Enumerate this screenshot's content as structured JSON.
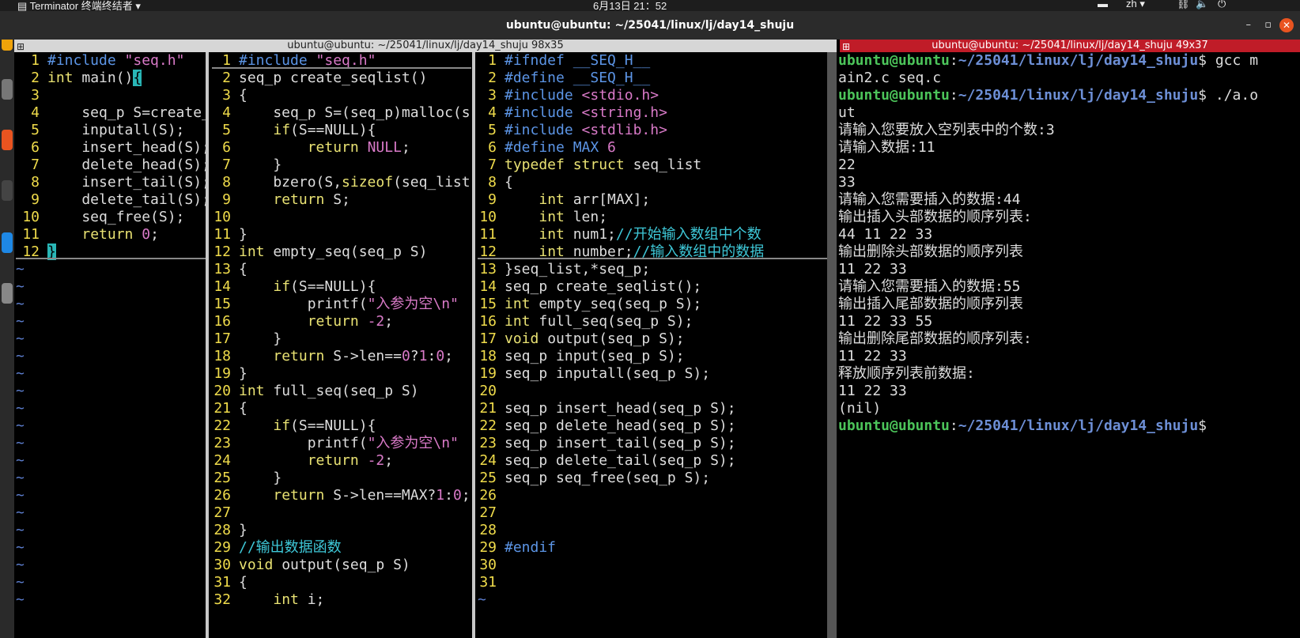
{
  "topbar": {
    "app_name": "Terminator 终端终结者",
    "clock": "6月13日 21：52",
    "input_method": "zh"
  },
  "window": {
    "title": "ubuntu@ubuntu: ~/25041/linux/lj/day14_shuju",
    "min": "–",
    "max": "▫",
    "close": "✕"
  },
  "left_bar": {
    "title": "ubuntu@ubuntu: ~/25041/linux/lj/day14_shuju 98x35"
  },
  "right_bar": {
    "title": "ubuntu@ubuntu: ~/25041/linux/lj/day14_shuju 49x37"
  },
  "pane1": {
    "lines": [
      [
        {
          "t": "#include ",
          "c": "pp"
        },
        {
          "t": "\"seq.h\"",
          "c": "str"
        }
      ],
      [
        {
          "t": "int",
          "c": "ty"
        },
        {
          "t": " main()",
          "c": "pl"
        },
        {
          "t": "{",
          "c": "cur"
        }
      ],
      [],
      [
        {
          "t": "    seq_p S=create_",
          "c": "pl"
        }
      ],
      [
        {
          "t": "    inputall(S);",
          "c": "pl"
        }
      ],
      [
        {
          "t": "    insert_head(S);",
          "c": "pl"
        }
      ],
      [
        {
          "t": "    delete_head(S);",
          "c": "pl"
        }
      ],
      [
        {
          "t": "    insert_tail(S);",
          "c": "pl"
        }
      ],
      [
        {
          "t": "    delete_tail(S);",
          "c": "pl"
        }
      ],
      [
        {
          "t": "    seq_free(S);",
          "c": "pl"
        }
      ],
      [
        {
          "t": "    ",
          "c": "pl"
        },
        {
          "t": "return",
          "c": "kw"
        },
        {
          "t": " ",
          "c": "pl"
        },
        {
          "t": "0",
          "c": "cn"
        },
        {
          "t": ";",
          "c": "pl"
        }
      ],
      [
        {
          "t": "}",
          "c": "cur"
        }
      ]
    ],
    "tildes": 20
  },
  "pane2": {
    "lines": [
      [
        {
          "t": "#include ",
          "c": "pp"
        },
        {
          "t": "\"seq.h\"",
          "c": "str"
        }
      ],
      [
        {
          "t": "seq_p create_seqlist()",
          "c": "pl"
        }
      ],
      [
        {
          "t": "{",
          "c": "pl"
        }
      ],
      [
        {
          "t": "    seq_p S=(seq_p)malloc(s",
          "c": "pl"
        }
      ],
      [
        {
          "t": "    ",
          "c": "pl"
        },
        {
          "t": "if",
          "c": "kw"
        },
        {
          "t": "(S==NULL){",
          "c": "pl"
        }
      ],
      [
        {
          "t": "        ",
          "c": "pl"
        },
        {
          "t": "return",
          "c": "kw"
        },
        {
          "t": " ",
          "c": "pl"
        },
        {
          "t": "NULL",
          "c": "cn"
        },
        {
          "t": ";",
          "c": "pl"
        }
      ],
      [
        {
          "t": "    }",
          "c": "pl"
        }
      ],
      [
        {
          "t": "    bzero(S,",
          "c": "pl"
        },
        {
          "t": "sizeof",
          "c": "kw"
        },
        {
          "t": "(seq_list",
          "c": "pl"
        }
      ],
      [
        {
          "t": "    ",
          "c": "pl"
        },
        {
          "t": "return",
          "c": "kw"
        },
        {
          "t": " S;",
          "c": "pl"
        }
      ],
      [],
      [
        {
          "t": "}",
          "c": "pl"
        }
      ],
      [
        {
          "t": "int",
          "c": "ty"
        },
        {
          "t": " empty_seq(seq_p S)",
          "c": "pl"
        }
      ],
      [
        {
          "t": "{",
          "c": "pl"
        }
      ],
      [
        {
          "t": "    ",
          "c": "pl"
        },
        {
          "t": "if",
          "c": "kw"
        },
        {
          "t": "(S==NULL){",
          "c": "pl"
        }
      ],
      [
        {
          "t": "        printf(",
          "c": "pl"
        },
        {
          "t": "\"入参为空\\n\"",
          "c": "str"
        }
      ],
      [
        {
          "t": "        ",
          "c": "pl"
        },
        {
          "t": "return",
          "c": "kw"
        },
        {
          "t": " ",
          "c": "pl"
        },
        {
          "t": "-2",
          "c": "cn"
        },
        {
          "t": ";",
          "c": "pl"
        }
      ],
      [
        {
          "t": "    }",
          "c": "pl"
        }
      ],
      [
        {
          "t": "    ",
          "c": "pl"
        },
        {
          "t": "return",
          "c": "kw"
        },
        {
          "t": " S->len==",
          "c": "pl"
        },
        {
          "t": "0",
          "c": "cn"
        },
        {
          "t": "?",
          "c": "pl"
        },
        {
          "t": "1",
          "c": "cn"
        },
        {
          "t": ":",
          "c": "pl"
        },
        {
          "t": "0",
          "c": "cn"
        },
        {
          "t": ";",
          "c": "pl"
        }
      ],
      [
        {
          "t": "}",
          "c": "pl"
        }
      ],
      [
        {
          "t": "int",
          "c": "ty"
        },
        {
          "t": " full_seq(seq_p S)",
          "c": "pl"
        }
      ],
      [
        {
          "t": "{",
          "c": "pl"
        }
      ],
      [
        {
          "t": "    ",
          "c": "pl"
        },
        {
          "t": "if",
          "c": "kw"
        },
        {
          "t": "(S==NULL){",
          "c": "pl"
        }
      ],
      [
        {
          "t": "        printf(",
          "c": "pl"
        },
        {
          "t": "\"入参为空\\n\"",
          "c": "str"
        }
      ],
      [
        {
          "t": "        ",
          "c": "pl"
        },
        {
          "t": "return",
          "c": "kw"
        },
        {
          "t": " ",
          "c": "pl"
        },
        {
          "t": "-2",
          "c": "cn"
        },
        {
          "t": ";",
          "c": "pl"
        }
      ],
      [
        {
          "t": "    }",
          "c": "pl"
        }
      ],
      [
        {
          "t": "    ",
          "c": "pl"
        },
        {
          "t": "return",
          "c": "kw"
        },
        {
          "t": " S->len==MAX?",
          "c": "pl"
        },
        {
          "t": "1",
          "c": "cn"
        },
        {
          "t": ":",
          "c": "pl"
        },
        {
          "t": "0",
          "c": "cn"
        },
        {
          "t": ";",
          "c": "pl"
        }
      ],
      [],
      [
        {
          "t": "}",
          "c": "pl"
        }
      ],
      [
        {
          "t": "//输出数据函数",
          "c": "cm"
        }
      ],
      [
        {
          "t": "void",
          "c": "ty"
        },
        {
          "t": " output(seq_p S)",
          "c": "pl"
        }
      ],
      [
        {
          "t": "{",
          "c": "pl"
        }
      ],
      [
        {
          "t": "    ",
          "c": "pl"
        },
        {
          "t": "int",
          "c": "ty"
        },
        {
          "t": " i;",
          "c": "pl"
        }
      ]
    ]
  },
  "pane3": {
    "lines": [
      [
        {
          "t": "#ifndef __SEQ_H__",
          "c": "pp"
        }
      ],
      [
        {
          "t": "#define __SEQ_H__",
          "c": "pp"
        }
      ],
      [
        {
          "t": "#include ",
          "c": "pp"
        },
        {
          "t": "<stdio.h>",
          "c": "str"
        }
      ],
      [
        {
          "t": "#include ",
          "c": "pp"
        },
        {
          "t": "<string.h>",
          "c": "str"
        }
      ],
      [
        {
          "t": "#include ",
          "c": "pp"
        },
        {
          "t": "<stdlib.h>",
          "c": "str"
        }
      ],
      [
        {
          "t": "#define MAX ",
          "c": "pp"
        },
        {
          "t": "6",
          "c": "cn"
        }
      ],
      [
        {
          "t": "typedef",
          "c": "ty"
        },
        {
          "t": " ",
          "c": "pl"
        },
        {
          "t": "struct",
          "c": "ty"
        },
        {
          "t": " seq_list",
          "c": "pl"
        }
      ],
      [
        {
          "t": "{",
          "c": "pl"
        }
      ],
      [
        {
          "t": "    ",
          "c": "pl"
        },
        {
          "t": "int",
          "c": "ty"
        },
        {
          "t": " arr[MAX];",
          "c": "pl"
        }
      ],
      [
        {
          "t": "    ",
          "c": "pl"
        },
        {
          "t": "int",
          "c": "ty"
        },
        {
          "t": " len;",
          "c": "pl"
        }
      ],
      [
        {
          "t": "    ",
          "c": "pl"
        },
        {
          "t": "int",
          "c": "ty"
        },
        {
          "t": " num1;",
          "c": "pl"
        },
        {
          "t": "//开始输入数组中个数",
          "c": "cm"
        }
      ],
      [
        {
          "t": "    ",
          "c": "pl"
        },
        {
          "t": "int",
          "c": "ty"
        },
        {
          "t": " number;",
          "c": "pl"
        },
        {
          "t": "//输入数组中的数据",
          "c": "cm"
        }
      ],
      [
        {
          "t": "}seq_list,*seq_p;",
          "c": "pl"
        }
      ],
      [
        {
          "t": "seq_p create_seqlist();",
          "c": "pl"
        }
      ],
      [
        {
          "t": "int",
          "c": "ty"
        },
        {
          "t": " empty_seq(seq_p S);",
          "c": "pl"
        }
      ],
      [
        {
          "t": "int",
          "c": "ty"
        },
        {
          "t": " full_seq(seq_p S);",
          "c": "pl"
        }
      ],
      [
        {
          "t": "void",
          "c": "ty"
        },
        {
          "t": " output(seq_p S);",
          "c": "pl"
        }
      ],
      [
        {
          "t": "seq_p input(seq_p S);",
          "c": "pl"
        }
      ],
      [
        {
          "t": "seq_p inputall(seq_p S);",
          "c": "pl"
        }
      ],
      [],
      [
        {
          "t": "seq_p insert_head(seq_p S);",
          "c": "pl"
        }
      ],
      [
        {
          "t": "seq_p delete_head(seq_p S);",
          "c": "pl"
        }
      ],
      [
        {
          "t": "seq_p insert_tail(seq_p S);",
          "c": "pl"
        }
      ],
      [
        {
          "t": "seq_p delete_tail(seq_p S);",
          "c": "pl"
        }
      ],
      [
        {
          "t": "seq_p seq_free(seq_p S);",
          "c": "pl"
        }
      ],
      [],
      [],
      [],
      [
        {
          "t": "#endif",
          "c": "pp"
        }
      ],
      [],
      []
    ]
  },
  "terminal": {
    "lines": [
      [
        {
          "t": "ubuntu@ubuntu",
          "c": "pu"
        },
        {
          "t": ":",
          "c": "pl"
        },
        {
          "t": "~/25041/linux/lj/day14_shuju",
          "c": "pd"
        },
        {
          "t": "$ gcc m",
          "c": "pl"
        }
      ],
      [
        {
          "t": "ain2.c seq.c",
          "c": "pl"
        }
      ],
      [
        {
          "t": "ubuntu@ubuntu",
          "c": "pu"
        },
        {
          "t": ":",
          "c": "pl"
        },
        {
          "t": "~/25041/linux/lj/day14_shuju",
          "c": "pd"
        },
        {
          "t": "$ ./a.o",
          "c": "pl"
        }
      ],
      [
        {
          "t": "ut",
          "c": "pl"
        }
      ],
      [
        {
          "t": "请输入您要放入空列表中的个数:3",
          "c": "pl"
        }
      ],
      [
        {
          "t": "请输入数据:11",
          "c": "pl"
        }
      ],
      [
        {
          "t": "22",
          "c": "pl"
        }
      ],
      [
        {
          "t": "33",
          "c": "pl"
        }
      ],
      [
        {
          "t": "请输入您需要插入的数据:44",
          "c": "pl"
        }
      ],
      [
        {
          "t": "输出插入头部数据的顺序列表:",
          "c": "pl"
        }
      ],
      [
        {
          "t": "44 11 22 33",
          "c": "pl"
        }
      ],
      [
        {
          "t": "输出删除头部数据的顺序列表",
          "c": "pl"
        }
      ],
      [
        {
          "t": "11 22 33",
          "c": "pl"
        }
      ],
      [
        {
          "t": "请输入您需要插入的数据:55",
          "c": "pl"
        }
      ],
      [
        {
          "t": "输出插入尾部数据的顺序列表",
          "c": "pl"
        }
      ],
      [
        {
          "t": "11 22 33 55",
          "c": "pl"
        }
      ],
      [
        {
          "t": "输出删除尾部数据的顺序列表:",
          "c": "pl"
        }
      ],
      [
        {
          "t": "11 22 33",
          "c": "pl"
        }
      ],
      [
        {
          "t": "释放顺序列表前数据:",
          "c": "pl"
        }
      ],
      [
        {
          "t": "11 22 33",
          "c": "pl"
        }
      ],
      [
        {
          "t": "(nil)",
          "c": "pl"
        }
      ],
      [
        {
          "t": "ubuntu@ubuntu",
          "c": "pu"
        },
        {
          "t": ":",
          "c": "pl"
        },
        {
          "t": "~/25041/linux/lj/day14_shuju",
          "c": "pd"
        },
        {
          "t": "$ ",
          "c": "pl"
        }
      ]
    ]
  },
  "colors": {
    "accent": "#e95420",
    "right_bar": "#c01c28",
    "line_number": "#f0dc4b",
    "prompt_user": "#4cc45a",
    "prompt_dir": "#6d8fd6"
  },
  "icons": [
    "terminal-icon",
    "close-icon",
    "minimize-icon",
    "maximize-icon",
    "network-icon",
    "volume-icon",
    "power-icon"
  ]
}
